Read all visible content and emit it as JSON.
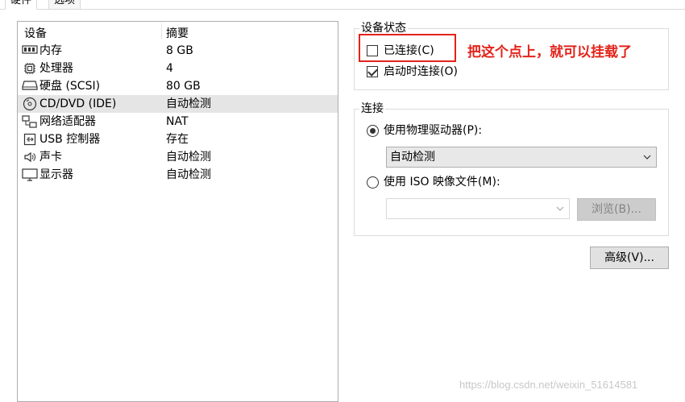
{
  "tabs": [
    {
      "label": "硬件"
    },
    {
      "label": "选项"
    }
  ],
  "device_list": {
    "columns": {
      "device": "设备",
      "summary": "摘要"
    },
    "rows": [
      {
        "icon": "memory-icon",
        "name": "内存",
        "value": "8 GB"
      },
      {
        "icon": "processor-icon",
        "name": "处理器",
        "value": "4"
      },
      {
        "icon": "harddisk-icon",
        "name": "硬盘 (SCSI)",
        "value": "80 GB"
      },
      {
        "icon": "cd-dvd-icon",
        "name": "CD/DVD (IDE)",
        "value": "自动检测",
        "selected": true
      },
      {
        "icon": "network-adapter-icon",
        "name": "网络适配器",
        "value": "NAT"
      },
      {
        "icon": "usb-icon",
        "name": "USB 控制器",
        "value": "存在"
      },
      {
        "icon": "sound-icon",
        "name": "声卡",
        "value": "自动检测"
      },
      {
        "icon": "display-icon",
        "name": "显示器",
        "value": "自动检测"
      }
    ]
  },
  "device_status": {
    "title": "设备状态",
    "connected": {
      "label": "已连接(C)",
      "checked": false
    },
    "connect_at_power_on": {
      "label": "启动时连接(O)",
      "checked": true
    }
  },
  "connection": {
    "title": "连接",
    "physical_drive": {
      "label": "使用物理驱动器(P):",
      "selected": true,
      "value": "自动检测"
    },
    "iso_image": {
      "label": "使用 ISO 映像文件(M):",
      "selected": false,
      "value": "",
      "browse_label": "浏览(B)..."
    }
  },
  "advanced_button": "高级(V)...",
  "annotation": {
    "text": "把这个点上，就可以挂载了",
    "color": "#e3231a"
  },
  "watermark": "https://blog.csdn.net/weixin_51614581"
}
